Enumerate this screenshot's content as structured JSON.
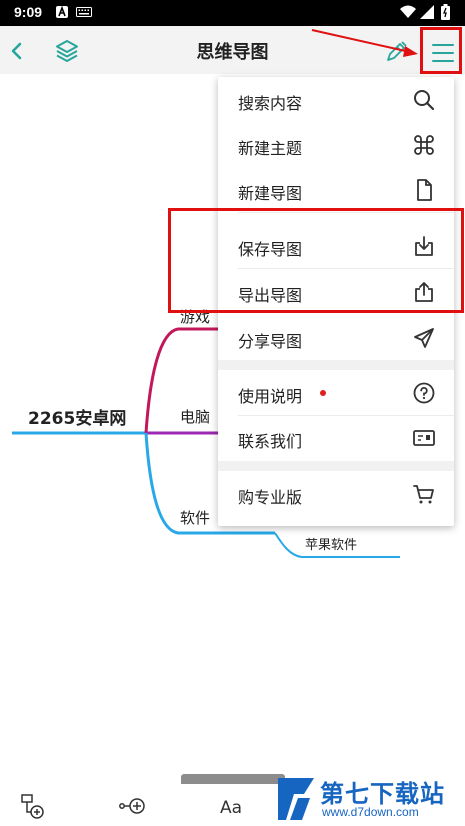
{
  "status_bar": {
    "time": "9:09"
  },
  "toolbar": {
    "title": "思维导图"
  },
  "mindmap": {
    "root": "2265安卓网",
    "branches": [
      {
        "label": "游戏"
      },
      {
        "label": "电脑"
      },
      {
        "label": "软件",
        "children": [
          {
            "label": "苹果软件"
          }
        ]
      }
    ]
  },
  "menu": {
    "items": [
      {
        "label": "搜索内容",
        "icon": "search-icon"
      },
      {
        "label": "新建主题",
        "icon": "command-icon"
      },
      {
        "label": "新建导图",
        "icon": "file-icon"
      },
      {
        "label": "保存导图",
        "icon": "download-icon"
      },
      {
        "label": "导出导图",
        "icon": "share-upload-icon"
      },
      {
        "label": "分享导图",
        "icon": "send-icon"
      },
      {
        "label": "使用说明",
        "icon": "help-icon"
      },
      {
        "label": "联系我们",
        "icon": "contact-card-icon"
      },
      {
        "label": "购专业版",
        "icon": "cart-icon"
      }
    ]
  },
  "colors": {
    "accent": "#26a69a",
    "branch_game": "#c2185b",
    "branch_pc": "#9c27b0",
    "branch_soft": "#29a8e8",
    "annotation": "#e01010",
    "watermark": "#1665c0"
  },
  "watermark": {
    "name": "第七下载站",
    "url": "www.d7down.com"
  }
}
